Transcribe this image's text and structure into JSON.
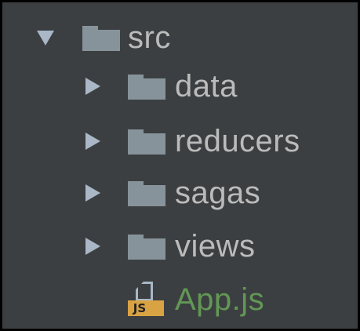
{
  "tree": {
    "root": {
      "label": "src",
      "expanded": true,
      "icon": "folder-icon"
    },
    "children": [
      {
        "label": "data",
        "type": "folder",
        "expanded": false,
        "icon": "folder-icon"
      },
      {
        "label": "reducers",
        "type": "folder",
        "expanded": false,
        "icon": "folder-icon"
      },
      {
        "label": "sagas",
        "type": "folder",
        "expanded": false,
        "icon": "folder-icon"
      },
      {
        "label": "views",
        "type": "folder",
        "expanded": false,
        "icon": "folder-icon"
      },
      {
        "label": "App.js",
        "type": "file",
        "icon": "javascript-file-icon",
        "badge": "JS"
      }
    ]
  },
  "colors": {
    "background": "#3c3f41",
    "text": "#bbbbbb",
    "js_file_text": "#629755",
    "folder": "#87939a",
    "arrow": "#a9b7c6",
    "js_badge": "#d9a343"
  }
}
